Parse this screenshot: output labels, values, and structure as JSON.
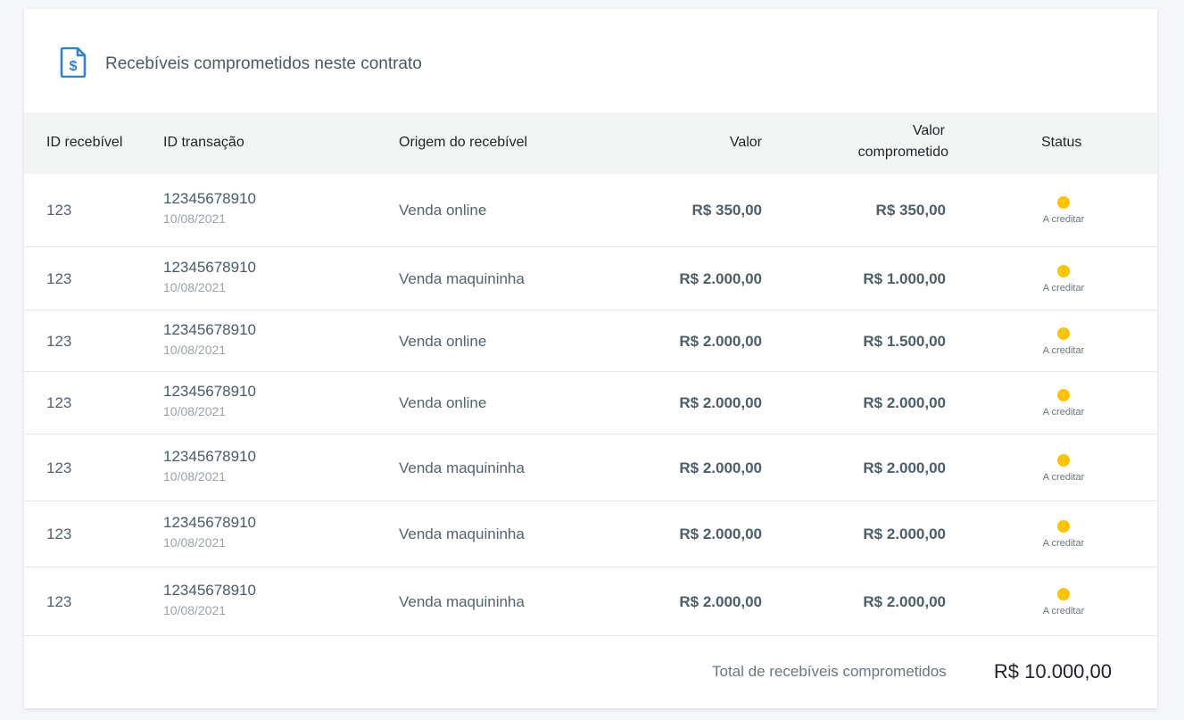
{
  "header": {
    "title": "Recebíveis comprometidos neste contrato",
    "icon": "document-dollar-icon",
    "icon_color": "#2f80d8"
  },
  "table": {
    "columns": {
      "id": "ID recebível",
      "transaction": "ID transação",
      "origin": "Origem do recebível",
      "value": "Valor",
      "committed_line1": "Valor",
      "committed_line2": "comprometido",
      "status": "Status"
    },
    "rows": [
      {
        "id": "123",
        "transaction": "12345678910",
        "date": "10/08/2021",
        "origin": "Venda online",
        "value": "R$ 350,00",
        "committed": "R$ 350,00",
        "status": "A creditar"
      },
      {
        "id": "123",
        "transaction": "12345678910",
        "date": "10/08/2021",
        "origin": "Venda maquininha",
        "value": "R$ 2.000,00",
        "committed": "R$ 1.000,00",
        "status": "A creditar"
      },
      {
        "id": "123",
        "transaction": "12345678910",
        "date": "10/08/2021",
        "origin": "Venda online",
        "value": "R$ 2.000,00",
        "committed": "R$ 1.500,00",
        "status": "A creditar"
      },
      {
        "id": "123",
        "transaction": "12345678910",
        "date": "10/08/2021",
        "origin": "Venda online",
        "value": "R$ 2.000,00",
        "committed": "R$ 2.000,00",
        "status": "A creditar"
      },
      {
        "id": "123",
        "transaction": "12345678910",
        "date": "10/08/2021",
        "origin": "Venda maquininha",
        "value": "R$ 2.000,00",
        "committed": "R$ 2.000,00",
        "status": "A creditar"
      },
      {
        "id": "123",
        "transaction": "12345678910",
        "date": "10/08/2021",
        "origin": "Venda maquininha",
        "value": "R$ 2.000,00",
        "committed": "R$ 2.000,00",
        "status": "A creditar"
      },
      {
        "id": "123",
        "transaction": "12345678910",
        "date": "10/08/2021",
        "origin": "Venda maquininha",
        "value": "R$ 2.000,00",
        "committed": "R$ 2.000,00",
        "status": "A creditar"
      }
    ],
    "status_color": "#ffc400"
  },
  "footer": {
    "total_label": "Total de recebíveis comprometidos",
    "total_value": "R$ 10.000,00"
  }
}
